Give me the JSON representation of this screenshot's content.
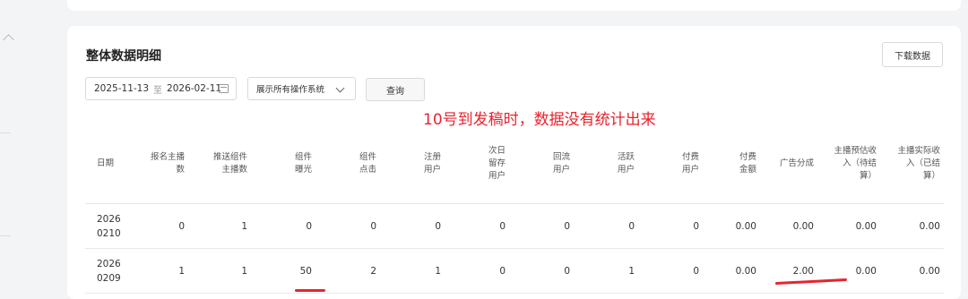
{
  "section": {
    "title": "整体数据明细",
    "download_label": "下载数据"
  },
  "filters": {
    "start_date": "2025-11-13",
    "separator": "至",
    "end_date": "2026-02-11",
    "os_selected": "展示所有操作系统",
    "query_label": "查询"
  },
  "annotation": "10号到发稿时，数据没有统计出来",
  "table": {
    "headers": [
      [
        "日期"
      ],
      [
        "报名主播",
        "数"
      ],
      [
        "推送组件",
        "主播数"
      ],
      [
        "组件",
        "曝光"
      ],
      [
        "组件",
        "点击"
      ],
      [
        "注册",
        "用户"
      ],
      [
        "次日",
        "留存",
        "用户"
      ],
      [
        "回流",
        "用户"
      ],
      [
        "活跃",
        "用户"
      ],
      [
        "付费",
        "用户"
      ],
      [
        "付费",
        "金额"
      ],
      [
        "广告分成"
      ],
      [
        "主播预估收",
        "入（待结",
        "算）"
      ],
      [
        "主播实际收",
        "入（已结",
        "算）"
      ]
    ],
    "rows": [
      {
        "date_l1": "2026",
        "date_l2": "0210",
        "cells": [
          "0",
          "1",
          "0",
          "0",
          "0",
          "0",
          "0",
          "0",
          "0",
          "0.00",
          "0.00",
          "0.00",
          "0.00"
        ]
      },
      {
        "date_l1": "2026",
        "date_l2": "0209",
        "cells": [
          "1",
          "1",
          "50",
          "2",
          "1",
          "0",
          "0",
          "1",
          "0",
          "0.00",
          "2.00",
          "0.00",
          "0.00"
        ]
      }
    ]
  },
  "colors": {
    "annotation_red": "#e8242e"
  }
}
